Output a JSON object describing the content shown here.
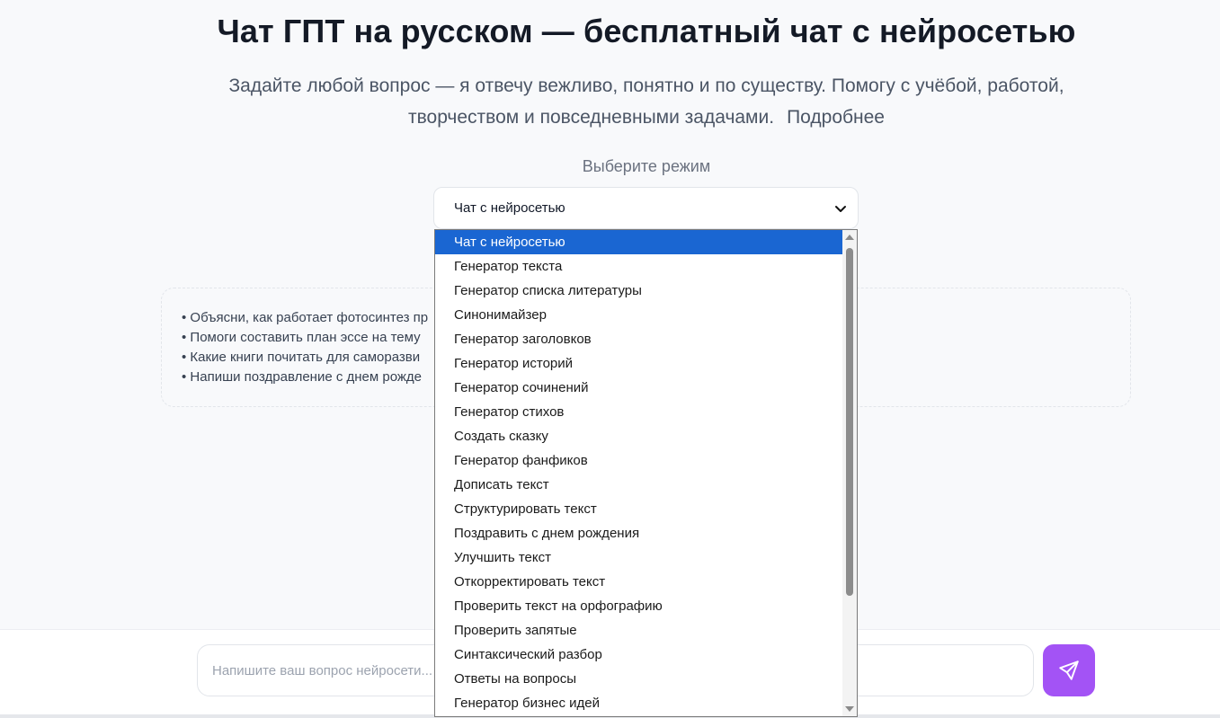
{
  "header": {
    "title": "Чат ГПТ на русском — бесплатный чат с нейросетью",
    "subtitle": "Задайте любой вопрос — я отвечу вежливо, понятно и по существу. Помогу с учёбой, работой, творчеством и повседневными задачами.",
    "more_link": "Подробнее"
  },
  "mode": {
    "label": "Выберите режим",
    "selected": "Чат с нейросетью",
    "options": [
      "Чат с нейросетью",
      "Генератор текста",
      "Генератор списка литературы",
      "Синонимайзер",
      "Генератор заголовков",
      "Генератор историй",
      "Генератор сочинений",
      "Генератор стихов",
      "Создать сказку",
      "Генератор фанфиков",
      "Дописать текст",
      "Структурировать текст",
      "Поздравить с днем рождения",
      "Улучшить текст",
      "Откорректировать текст",
      "Проверить текст на орфографию",
      "Проверить запятые",
      "Синтаксический разбор",
      "Ответы на вопросы",
      "Генератор бизнес идей"
    ]
  },
  "examples": [
    "Объясни, как работает фотосинтез пр",
    "Помоги составить план эссе на тему",
    "Какие книги почитать для саморазви",
    "Напиши поздравление с днем рожде"
  ],
  "composer": {
    "placeholder": "Напишите ваш вопрос нейросети..."
  },
  "colors": {
    "accent": "#a353f5",
    "selected_option": "#1a66d2"
  },
  "icons": {
    "send": "send-icon",
    "chevron": "chevron-down-icon"
  }
}
